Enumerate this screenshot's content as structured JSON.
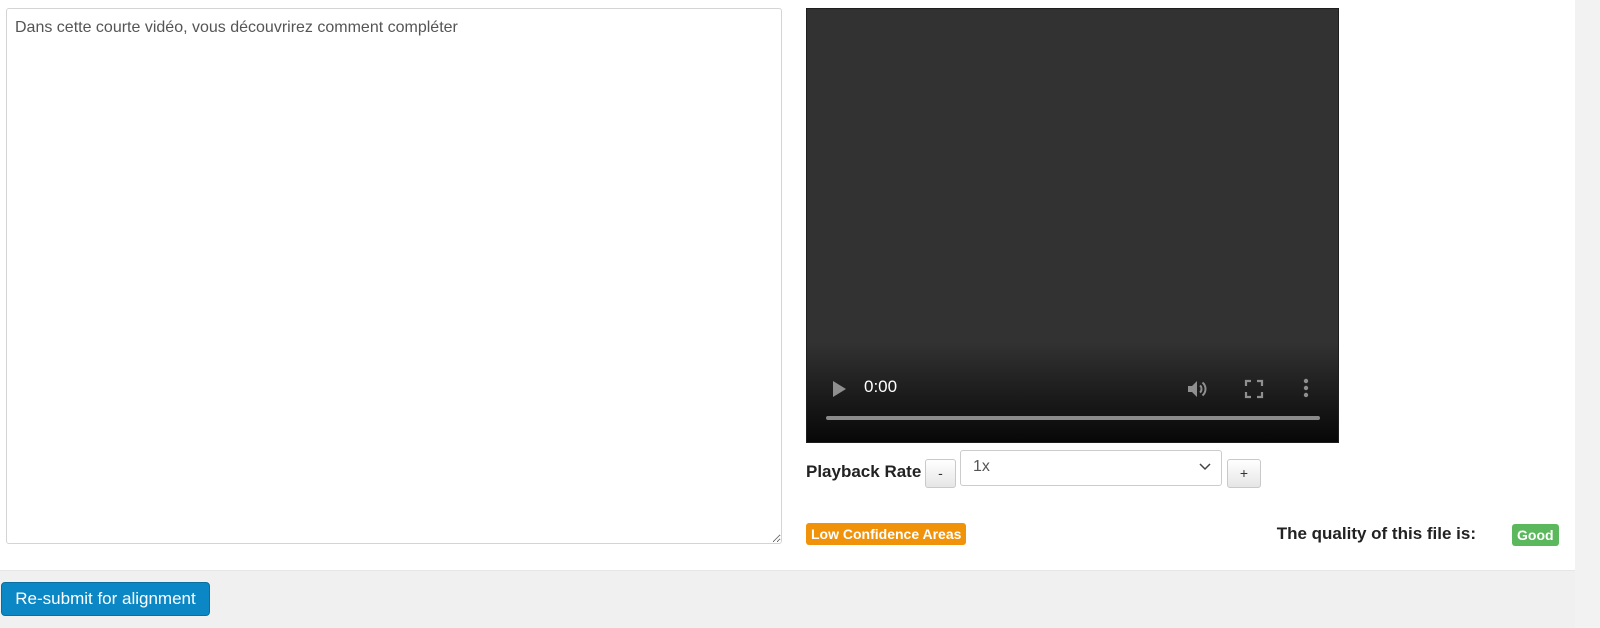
{
  "transcript": {
    "text": "Dans cette courte vidéo, vous découvrirez comment compléter"
  },
  "video": {
    "current_time": "0:00",
    "progress_fraction": 0,
    "icons": {
      "play": "play-icon",
      "volume": "volume-icon",
      "fullscreen": "fullscreen-icon",
      "more": "more-options-icon"
    }
  },
  "playback": {
    "label": "Playback Rate",
    "decrease_label": "-",
    "increase_label": "+",
    "selected_rate": "1x"
  },
  "status": {
    "low_confidence_label": "Low Confidence Areas",
    "quality_label": "The quality of this file is:",
    "quality_value": "Good"
  },
  "footer": {
    "resubmit_label": "Re-submit for alignment"
  },
  "colors": {
    "accent_blue": "#0a87c4",
    "warning_orange": "#f0930a",
    "success_green": "#5cb85c",
    "video_bg": "#323232"
  }
}
